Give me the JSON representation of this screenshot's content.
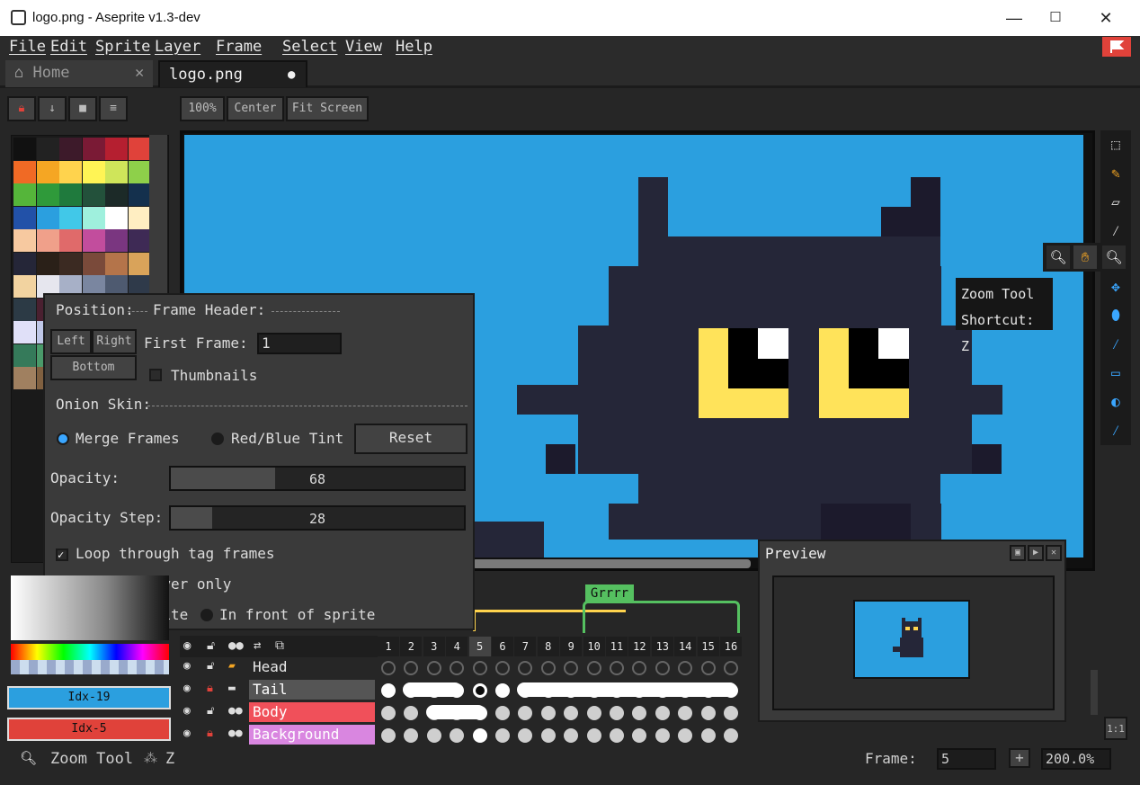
{
  "titlebar": {
    "title": "logo.png - Aseprite v1.3-dev",
    "minimize": "—",
    "maximize": "☐",
    "close": "✕"
  },
  "menu": {
    "items": [
      "File",
      "Edit",
      "Sprite",
      "Layer",
      "Frame",
      "Select",
      "View",
      "Help"
    ]
  },
  "tabs": [
    {
      "label": "Home",
      "close": "✕",
      "icon": "home-icon"
    },
    {
      "label": "logo.png",
      "modified_dot": "●"
    }
  ],
  "toolbar": {
    "zoom_100": "100%",
    "center": "Center",
    "fit_screen": "Fit Screen"
  },
  "tooltip": {
    "title": "Zoom Tool",
    "shortcut": "Shortcut: Z"
  },
  "onion": {
    "position_label": "Position:",
    "left": "Left",
    "right": "Right",
    "bottom": "Bottom",
    "frame_header_label": "Frame Header:",
    "first_frame_label": "First Frame:",
    "first_frame_value": "1",
    "thumbnails_label": "Thumbnails",
    "onion_skin_label": "Onion Skin:",
    "merge_frames": "Merge Frames",
    "red_blue_tint": "Red/Blue Tint",
    "reset": "Reset",
    "opacity_label": "Opacity:",
    "opacity_value": "68",
    "opacity_fraction": 0.356,
    "opacity_step_label": "Opacity Step:",
    "opacity_step_value": "28",
    "opacity_step_fraction": 0.14,
    "loop_label": "Loop through tag frames",
    "current_layer_label": "Current layer only",
    "behind_label": "Behind sprite",
    "in_front_label": "In front of sprite"
  },
  "timeline": {
    "tag": "Grrrr",
    "frames": [
      "1",
      "2",
      "3",
      "4",
      "5",
      "6",
      "7",
      "8",
      "9",
      "10",
      "11",
      "12",
      "13",
      "14",
      "15",
      "16"
    ],
    "layers": [
      {
        "name": "Head",
        "color": "#262626",
        "text": "#e8e8e8"
      },
      {
        "name": "Tail",
        "color": "#555555",
        "text": "#ffffff"
      },
      {
        "name": "Body",
        "color": "#f0505a",
        "text": "#ffffff"
      },
      {
        "name": "Background",
        "color": "#d986e0",
        "text": "#ffffff"
      }
    ]
  },
  "preview": {
    "title": "Preview"
  },
  "colors": {
    "fg_label": "Idx-19",
    "bg_label": "Idx-5",
    "fg": "#2b9fdf",
    "bg": "#e0423a"
  },
  "status": {
    "tool": "Zoom Tool",
    "shortcut": "Z",
    "frame_label": "Frame:",
    "frame_value": "5",
    "plus": "+",
    "zoom": "200.0%",
    "ratio": "1:1"
  },
  "palette": [
    "#111111",
    "#222222",
    "#3d1a2a",
    "#7a1a35",
    "#b51f30",
    "#e0423a",
    "#f06a25",
    "#f5a623",
    "#ffd34d",
    "#fff455",
    "#cfe55a",
    "#8ed04a",
    "#55b53a",
    "#2f9a3a",
    "#1f7a3d",
    "#23513b",
    "#1c2a28",
    "#14304d",
    "#2251a8",
    "#2b9fdf",
    "#41c8e8",
    "#9ff0dd",
    "#ffffff",
    "#ffeec2",
    "#f7c9a0",
    "#f0a08a",
    "#e06a6a",
    "#c24d9d",
    "#7a3680",
    "#3e2a55",
    "#252638",
    "#2a2018",
    "#3b2a22",
    "#7a4a3a",
    "#b4744a",
    "#d9a35a",
    "#f2d3a0",
    "#e6e6ee",
    "#a7b0c7",
    "#7a86a0",
    "#4e5a70",
    "#2f3a4a",
    "#2c3a45",
    "#4a2030",
    "#6a3a50",
    "#8a5a70",
    "#b08aa0",
    "#d0b0c0",
    "#e0e0f8",
    "#c0c8e8",
    "#9aa8d0",
    "#7080b0",
    "#50608a",
    "#303e60",
    "#357a5a",
    "#4a9a6a",
    "#6ab47a",
    "#9ad08a",
    "#c8e8a8",
    "#e8f8d0",
    "#a08060",
    "#806040",
    "#604830",
    "#403020",
    "#c0a080",
    "#e0c8a8"
  ]
}
